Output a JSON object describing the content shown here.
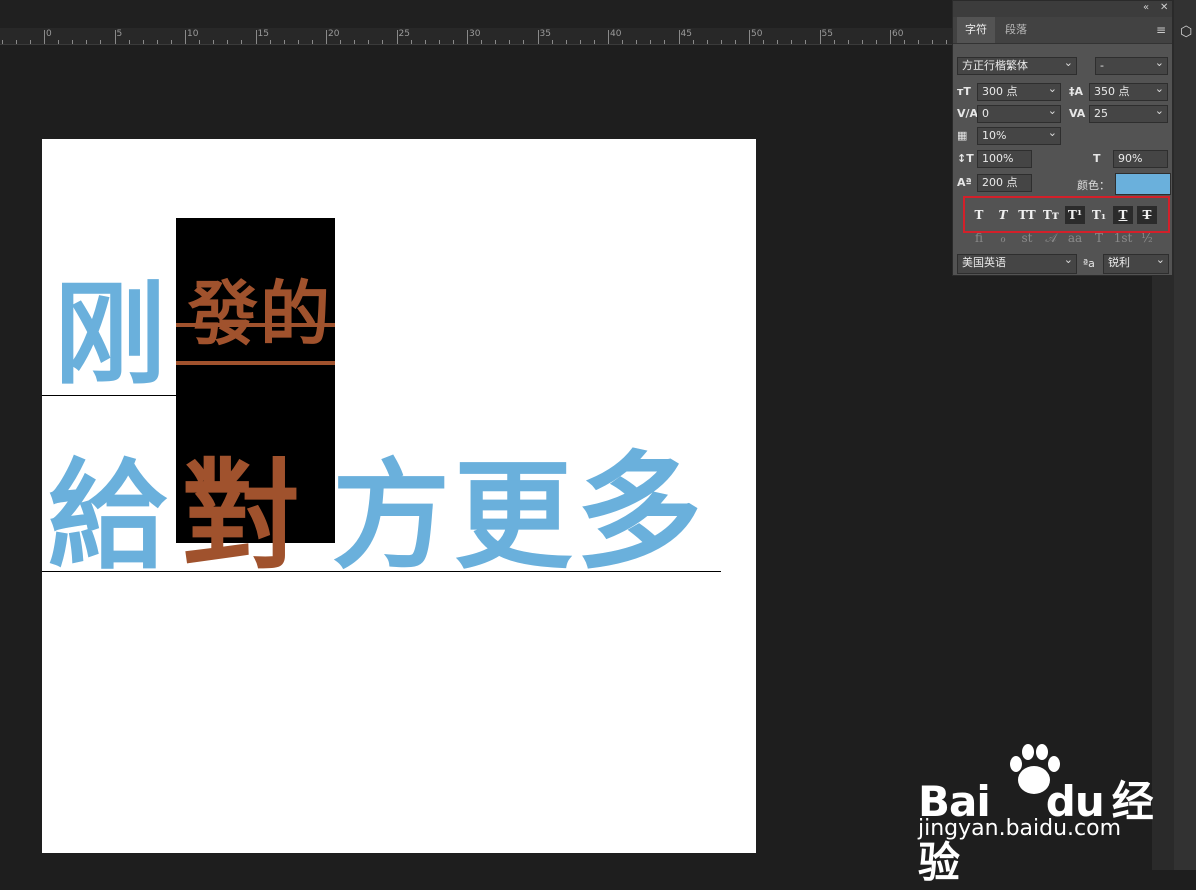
{
  "ruler": {
    "labels": [
      "0",
      "5",
      "10",
      "15",
      "20",
      "25",
      "30",
      "35",
      "40",
      "45",
      "50",
      "55",
      "60"
    ]
  },
  "canvas": {
    "line1_blue": "刚",
    "line1_brown": [
      "發",
      "的"
    ],
    "line2_blue_left": "給",
    "line2_brown": "對",
    "line2_blue_right": [
      "方",
      "更",
      "多"
    ],
    "text_color": "#6ab0dc",
    "accent_text_color": "#a0522d"
  },
  "panel": {
    "tabs": [
      "字符",
      "段落"
    ],
    "font_family": "方正行楷繁体",
    "font_style": "-",
    "font_size": "300 点",
    "leading": "350 点",
    "kerning": "0",
    "tracking": "25",
    "tsume": "10%",
    "vertical_scale": "100%",
    "horizontal_scale": "90%",
    "baseline_shift": "200 点",
    "color_label": "颜色：",
    "color": "#6ab0dc",
    "style_buttons": [
      "T",
      "T",
      "TT",
      "Tт",
      "T¹",
      "T₁",
      "T",
      "T"
    ],
    "opentype_buttons": [
      "fi",
      "ℴ",
      "st",
      "𝒜",
      "aa",
      "T",
      "1st",
      "½"
    ],
    "language": "美国英语",
    "aa_icon": "ªa",
    "antialias": "锐利"
  },
  "watermark": {
    "brand": "Bai",
    "brand2": "du",
    "brand3": "经验",
    "url": "jingyan.baidu.com"
  }
}
